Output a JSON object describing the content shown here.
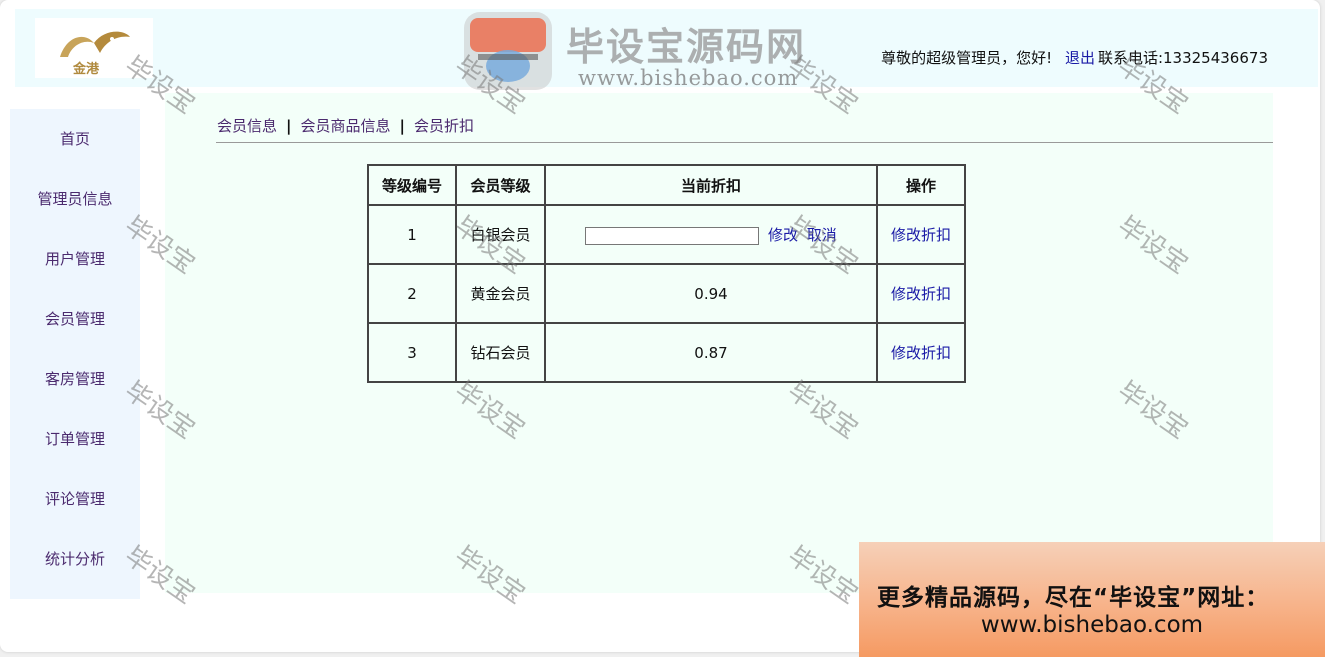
{
  "header": {
    "logo_text": "金港",
    "greeting": "尊敬的超级管理员，您好!",
    "logout": "退出",
    "contact": "联系电话:13325436673"
  },
  "sidebar": {
    "items": [
      {
        "label": "首页"
      },
      {
        "label": "管理员信息"
      },
      {
        "label": "用户管理"
      },
      {
        "label": "会员管理"
      },
      {
        "label": "客房管理"
      },
      {
        "label": "订单管理"
      },
      {
        "label": "评论管理"
      },
      {
        "label": "统计分析"
      }
    ]
  },
  "breadcrumb": {
    "items": [
      "会员信息",
      "会员商品信息",
      "会员折扣"
    ],
    "separator": "|"
  },
  "table": {
    "headers": [
      "等级编号",
      "会员等级",
      "当前折扣",
      "操作"
    ],
    "rows": [
      {
        "id": "1",
        "level": "白银会员",
        "discount": "",
        "edit": "修改",
        "cancel": "取消",
        "action": "修改折扣"
      },
      {
        "id": "2",
        "level": "黄金会员",
        "discount": "0.94",
        "action": "修改折扣"
      },
      {
        "id": "3",
        "level": "钻石会员",
        "discount": "0.87",
        "action": "修改折扣"
      }
    ]
  },
  "watermark": {
    "text": "毕设宝",
    "brand_title": "毕设宝源码网",
    "brand_url": "www.bishebao.com",
    "badge_text": "毕设宝"
  },
  "banner": {
    "line1": "更多精品源码，尽在“毕设宝”网址：",
    "line2": "www.bishebao.com"
  },
  "colors": {
    "header_bg": "#eefcfe",
    "sidebar_bg": "#eef6fe",
    "content_bg": "#f3fff9",
    "link": "#1a1aa6",
    "nav_text": "#4b2a6e"
  }
}
